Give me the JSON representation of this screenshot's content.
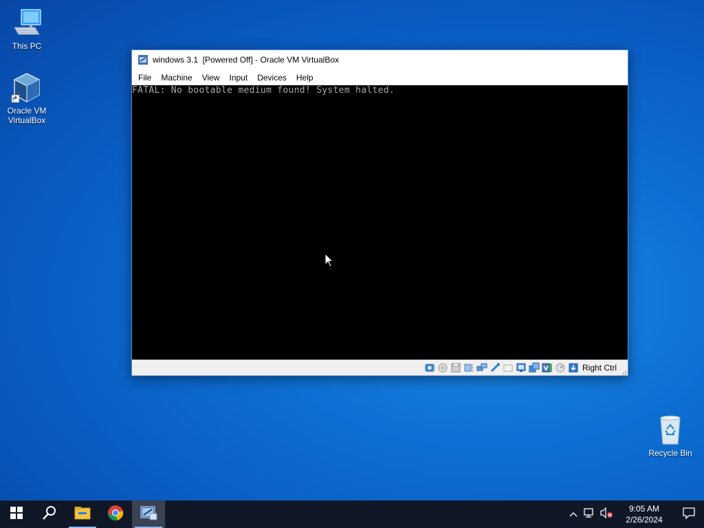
{
  "desktop": {
    "icons": [
      {
        "label": "This PC",
        "icon": "this-pc-icon"
      },
      {
        "label_line1": "Oracle VM",
        "label_line2": "VirtualBox",
        "icon": "virtualbox-icon"
      },
      {
        "label": "Recycle Bin",
        "icon": "recycle-bin-icon"
      }
    ]
  },
  "window": {
    "title": "windows 3.1  [Powered Off] - Oracle VM VirtualBox",
    "menu": [
      "File",
      "Machine",
      "View",
      "Input",
      "Devices",
      "Help"
    ],
    "console_text": "FATAL: No bootable medium found! System halted.",
    "host_key": "Right Ctrl",
    "status_icons": [
      "hard-disk-icon",
      "optical-drive-icon",
      "floppy-icon",
      "audio-icon",
      "network-icon",
      "usb-icon",
      "shared-folders-icon",
      "display-icon",
      "recording-icon",
      "virtualization-icon",
      "cpu-icon",
      "mouse-integration-icon",
      "host-key-arrow-icon"
    ]
  },
  "taskbar": {
    "apps": [
      "start-icon",
      "search-icon",
      "file-explorer-icon",
      "chrome-icon",
      "virtualbox-taskbar-icon"
    ],
    "clock": {
      "time": "9:05 AM",
      "date": "2/26/2024"
    },
    "tray": [
      "chevron-up-icon",
      "network-tray-icon",
      "volume-muted-icon"
    ]
  },
  "colors": {
    "desktop_bg": "#0a5cc2",
    "taskbar_bg": "#101828",
    "console_text": "#a8a8a8",
    "console_bg": "#000000"
  }
}
